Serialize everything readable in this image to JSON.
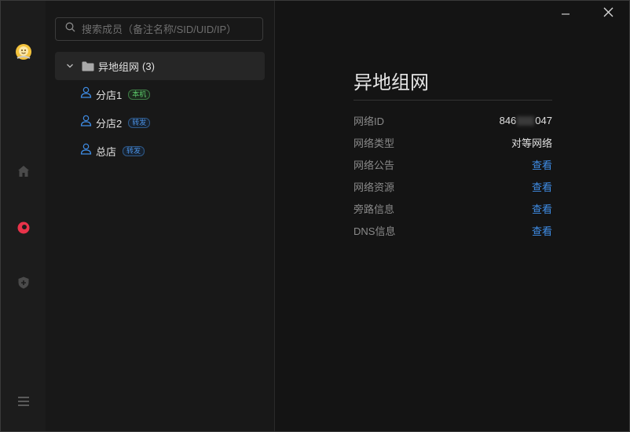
{
  "search": {
    "placeholder": "搜索成员（备注名称/SID/UID/IP）"
  },
  "tree": {
    "group": {
      "name": "异地组网",
      "count": "(3)"
    },
    "members": [
      {
        "name": "分店1",
        "badge": "本机",
        "badge_type": "self"
      },
      {
        "name": "分店2",
        "badge": "转发",
        "badge_type": "relay"
      },
      {
        "name": "总店",
        "badge": "转发",
        "badge_type": "relay"
      }
    ]
  },
  "detail": {
    "title": "异地组网",
    "rows": [
      {
        "label": "网络ID",
        "value_prefix": "846",
        "value_suffix": "047"
      },
      {
        "label": "网络类型",
        "value": "对等网络"
      },
      {
        "label": "网络公告",
        "link": "查看"
      },
      {
        "label": "网络资源",
        "link": "查看"
      },
      {
        "label": "旁路信息",
        "link": "查看"
      },
      {
        "label": "DNS信息",
        "link": "查看"
      }
    ]
  },
  "rail": {
    "icons": [
      "avatar-icon",
      "home-icon",
      "network-icon",
      "shield-icon",
      "menu-icon"
    ]
  },
  "colors": {
    "accent_link": "#3f8ee8",
    "self_badge": "#5cc96a",
    "relay_badge": "#4a90e2",
    "network_icon": "#e8334a"
  }
}
